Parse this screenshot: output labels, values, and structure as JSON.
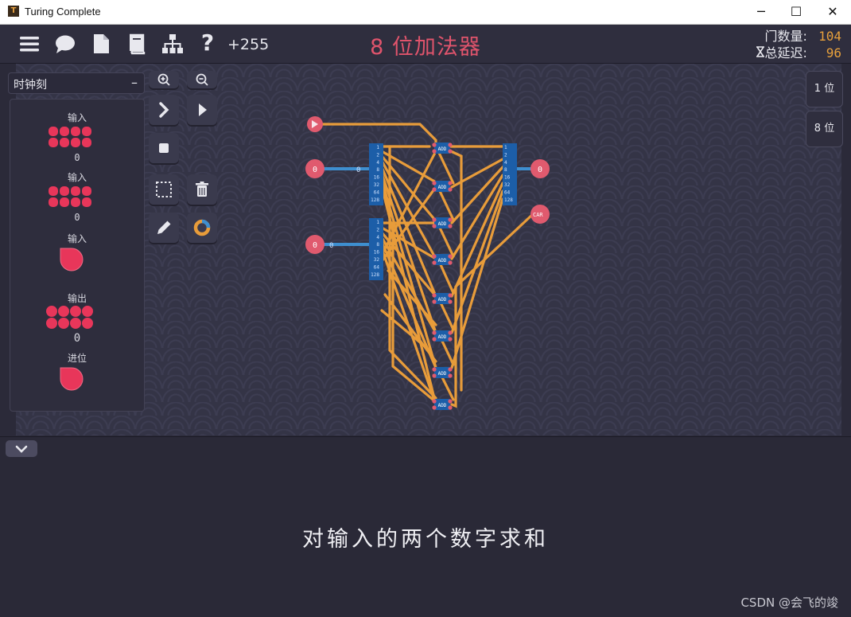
{
  "window": {
    "title": "Turing Complete",
    "minimize": "─",
    "maximize": "☐",
    "close": "✕",
    "app_icon": "T"
  },
  "toolbar": {
    "icons": [
      "menu-icon",
      "chat-icon",
      "document-icon",
      "book-icon",
      "hierarchy-icon",
      "help-icon"
    ],
    "help_glyph": "?",
    "score": "+255"
  },
  "level": {
    "title": "8 位加法器"
  },
  "stats": {
    "gates_label": "门数量:",
    "gates_value": "104",
    "delay_label": "总延迟:",
    "delay_value": "96",
    "delay_icon": "hourglass-icon"
  },
  "clock": {
    "label": "时钟刻",
    "collapse": "–"
  },
  "components": [
    {
      "label": "输入",
      "value": "0"
    },
    {
      "label": "输入",
      "value": "0"
    },
    {
      "label": "输入"
    },
    {
      "label": "输出",
      "value": "0"
    },
    {
      "label": "进位"
    }
  ],
  "bitwidth": {
    "one": "1 位",
    "eight": "8 位"
  },
  "circuit": {
    "input_a_value": "0",
    "input_b_value": "0",
    "output_value": "0",
    "carry_label": "CAR",
    "adder_label": "ADD",
    "bit_labels": [
      "1",
      "2",
      "4",
      "8",
      "16",
      "32",
      "64",
      "128"
    ],
    "colors": {
      "wire": "#e89c3a",
      "bus": "#3e8fd0",
      "pin": "#e05a6e",
      "splitter": "#1c5ea8"
    }
  },
  "description": "对输入的两个数字求和",
  "watermark": "CSDN @会飞的竣"
}
